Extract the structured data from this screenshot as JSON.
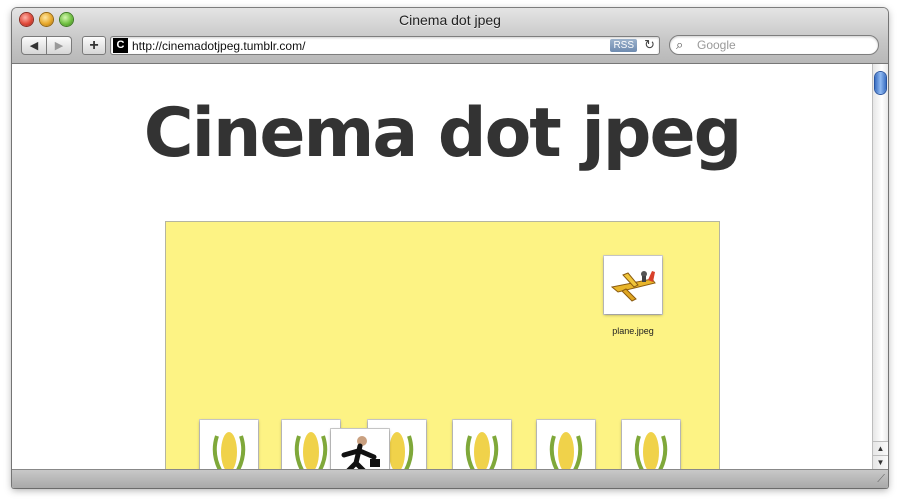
{
  "window": {
    "title": "Cinema dot jpeg"
  },
  "toolbar": {
    "back_glyph": "◀",
    "forward_glyph": "▶",
    "add_bookmark_glyph": "+",
    "favicon_letter": "C",
    "url": "http://cinemadotjpeg.tumblr.com/",
    "rss_label": "RSS",
    "reload_glyph": "↻",
    "search_placeholder": "Google",
    "search_glyph": "⌕"
  },
  "page": {
    "site_title": "Cinema dot jpeg",
    "desktop_color": "#fdf384",
    "files": [
      {
        "name": "plane.jpeg",
        "icon": "plane-image-icon"
      }
    ],
    "thumbnails": [
      {
        "icon": "corn-image-icon"
      },
      {
        "icon": "corn-image-icon"
      },
      {
        "icon": "corn-image-icon"
      },
      {
        "icon": "corn-image-icon"
      },
      {
        "icon": "corn-image-icon"
      },
      {
        "icon": "corn-image-icon"
      },
      {
        "icon": "running-man-image-icon"
      }
    ]
  },
  "scrollbar": {
    "up_glyph": "▲",
    "down_glyph": "▼"
  },
  "statusbar": {
    "grip_glyph": "⟋"
  }
}
